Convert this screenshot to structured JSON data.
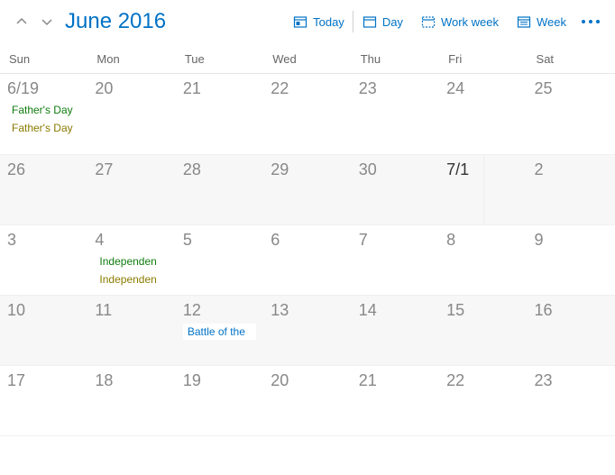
{
  "header": {
    "title": "June 2016",
    "buttons": {
      "today": "Today",
      "day": "Day",
      "workweek": "Work week",
      "week": "Week"
    }
  },
  "weekdays": [
    "Sun",
    "Mon",
    "Tue",
    "Wed",
    "Thu",
    "Fri",
    "Sat"
  ],
  "rows": [
    {
      "height": "h-tall",
      "cells": [
        {
          "label": "6/19",
          "events": [
            {
              "text": "Father's Day",
              "cls": "green"
            },
            {
              "text": "Father's Day",
              "cls": "olive"
            }
          ]
        },
        {
          "label": "20"
        },
        {
          "label": "21"
        },
        {
          "label": "22"
        },
        {
          "label": "23"
        },
        {
          "label": "24"
        },
        {
          "label": "25"
        }
      ]
    },
    {
      "height": "h-short",
      "cells": [
        {
          "label": "26",
          "shaded": true
        },
        {
          "label": "27",
          "shaded": true
        },
        {
          "label": "28",
          "shaded": true
        },
        {
          "label": "29",
          "shaded": true
        },
        {
          "label": "30",
          "shaded": true
        },
        {
          "label": "7/1",
          "strong": true,
          "shaded": true,
          "split": true
        },
        {
          "label": "2",
          "shaded": true
        }
      ]
    },
    {
      "height": "h-short",
      "cells": [
        {
          "label": "3"
        },
        {
          "label": "4",
          "events": [
            {
              "text": "Independen",
              "cls": "green"
            },
            {
              "text": "Independen",
              "cls": "olive"
            }
          ]
        },
        {
          "label": "5"
        },
        {
          "label": "6"
        },
        {
          "label": "7"
        },
        {
          "label": "8"
        },
        {
          "label": "9"
        }
      ]
    },
    {
      "height": "h-short",
      "cells": [
        {
          "label": "10",
          "shaded": true
        },
        {
          "label": "11",
          "shaded": true
        },
        {
          "label": "12",
          "shaded": true,
          "events": [
            {
              "text": "Battle of the",
              "cls": "blue"
            }
          ]
        },
        {
          "label": "13",
          "shaded": true
        },
        {
          "label": "14",
          "shaded": true
        },
        {
          "label": "15",
          "shaded": true
        },
        {
          "label": "16",
          "shaded": true
        }
      ]
    },
    {
      "height": "h-short",
      "cells": [
        {
          "label": "17"
        },
        {
          "label": "18"
        },
        {
          "label": "19"
        },
        {
          "label": "20"
        },
        {
          "label": "21"
        },
        {
          "label": "22"
        },
        {
          "label": "23"
        }
      ]
    }
  ]
}
